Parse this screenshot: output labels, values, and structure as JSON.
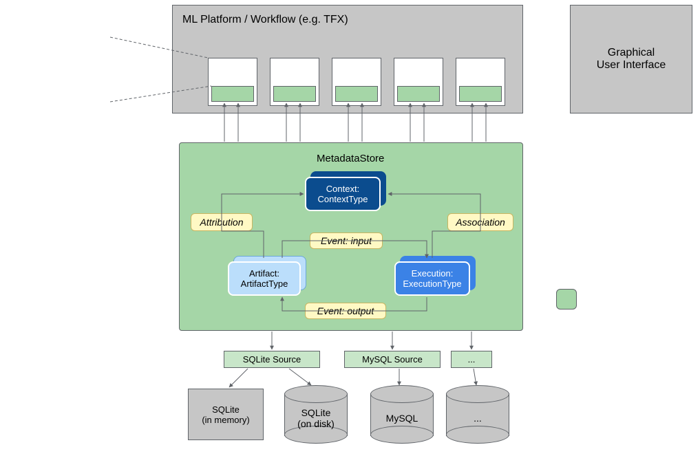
{
  "platform": {
    "title": "ML Platform / Workflow (e.g. TFX)"
  },
  "gui": {
    "line1": "Graphical",
    "line2": "User Interface"
  },
  "metadataStore": {
    "title": "MetadataStore",
    "context": {
      "line1": "Context:",
      "line2": "ContextType"
    },
    "artifact": {
      "line1": "Artifact:",
      "line2": "ArtifactType"
    },
    "execution": {
      "line1": "Execution:",
      "line2": "ExecutionType"
    },
    "attribution": "Attribution",
    "association": "Association",
    "eventInput": "Event: input",
    "eventOutput": "Event: output"
  },
  "sources": {
    "sqlite": "SQLite Source",
    "mysql": "MySQL Source",
    "other": "..."
  },
  "storage": {
    "sqliteMem": {
      "line1": "SQLite",
      "line2": "(in memory)"
    },
    "sqliteDisk": {
      "line1": "SQLite",
      "line2": "(on disk)"
    },
    "mysql": "MySQL",
    "other": "..."
  }
}
